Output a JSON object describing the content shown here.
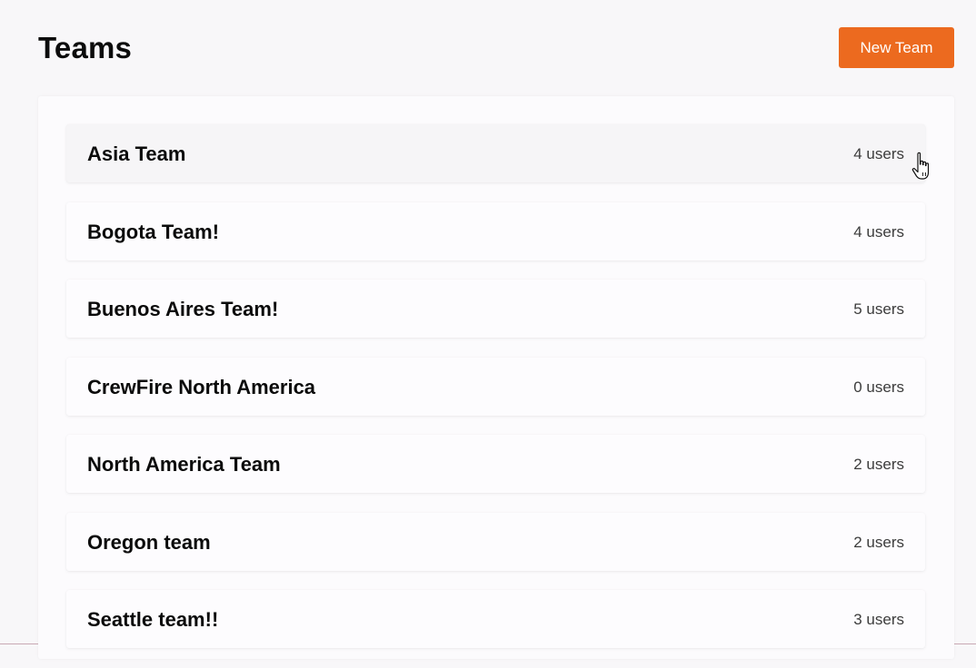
{
  "header": {
    "title": "Teams",
    "new_team_label": "New Team"
  },
  "colors": {
    "accent": "#ec6a1f",
    "background": "#f8f7f9",
    "card": "#fdfcfe"
  },
  "teams": [
    {
      "name": "Asia Team",
      "count": "4 users"
    },
    {
      "name": "Bogota Team!",
      "count": "4 users"
    },
    {
      "name": "Buenos Aires Team!",
      "count": "5 users"
    },
    {
      "name": "CrewFire North America",
      "count": "0 users"
    },
    {
      "name": "North America Team",
      "count": "2 users"
    },
    {
      "name": "Oregon team",
      "count": "2 users"
    },
    {
      "name": "Seattle team!!",
      "count": "3 users"
    }
  ],
  "cursor": {
    "icon": "hand-pointer-icon"
  }
}
